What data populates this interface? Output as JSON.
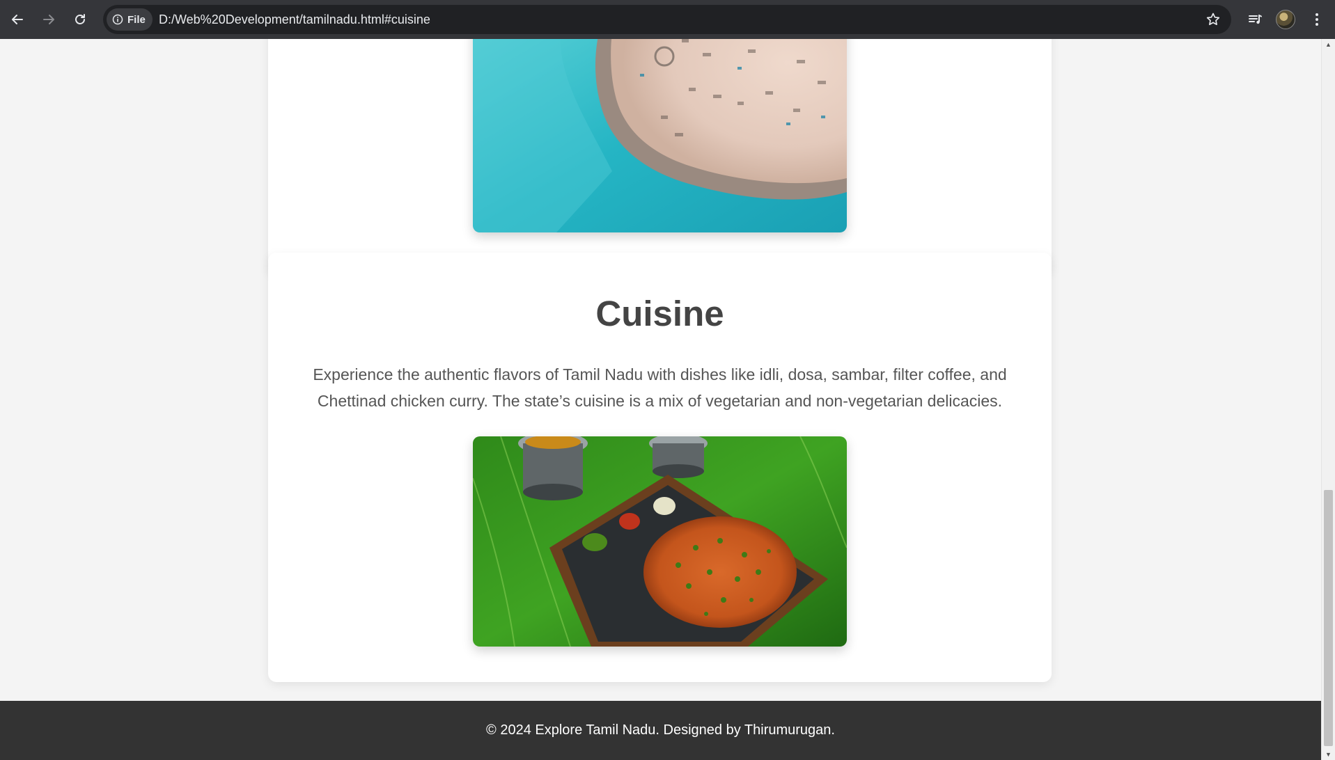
{
  "browser": {
    "site_chip_label": "File",
    "url": "D:/Web%20Development/tamilnadu.html#cuisine",
    "icons": [
      "back-arrow-icon",
      "forward-arrow-icon",
      "reload-icon",
      "info-icon",
      "star-icon",
      "reading-list-icon",
      "profile-avatar",
      "more-vert-icon"
    ]
  },
  "page": {
    "top_section": {
      "image_description": "Aerial view of a turquoise sea beside a rocky sandy breakwater with parked vehicles"
    },
    "cuisine": {
      "title": "Cuisine",
      "description": "Experience the authentic flavors of Tamil Nadu with dishes like idli, dosa, sambar, filter coffee, and Chettinad chicken curry. The state’s cuisine is a mix of vegetarian and non-vegetarian delicacies.",
      "image_description": "Dosa served on a wooden tray with chutneys on a banana leaf and steel tumblers"
    },
    "footer": {
      "text": "© 2024 Explore Tamil Nadu. Designed by Thirumurugan."
    }
  },
  "colors": {
    "chrome_bg": "#35363a",
    "omnibox_bg": "#202124",
    "page_bg": "#f4f4f4",
    "card_bg": "#ffffff",
    "heading": "#444444",
    "body_text": "#555555",
    "footer_bg": "#333333"
  }
}
